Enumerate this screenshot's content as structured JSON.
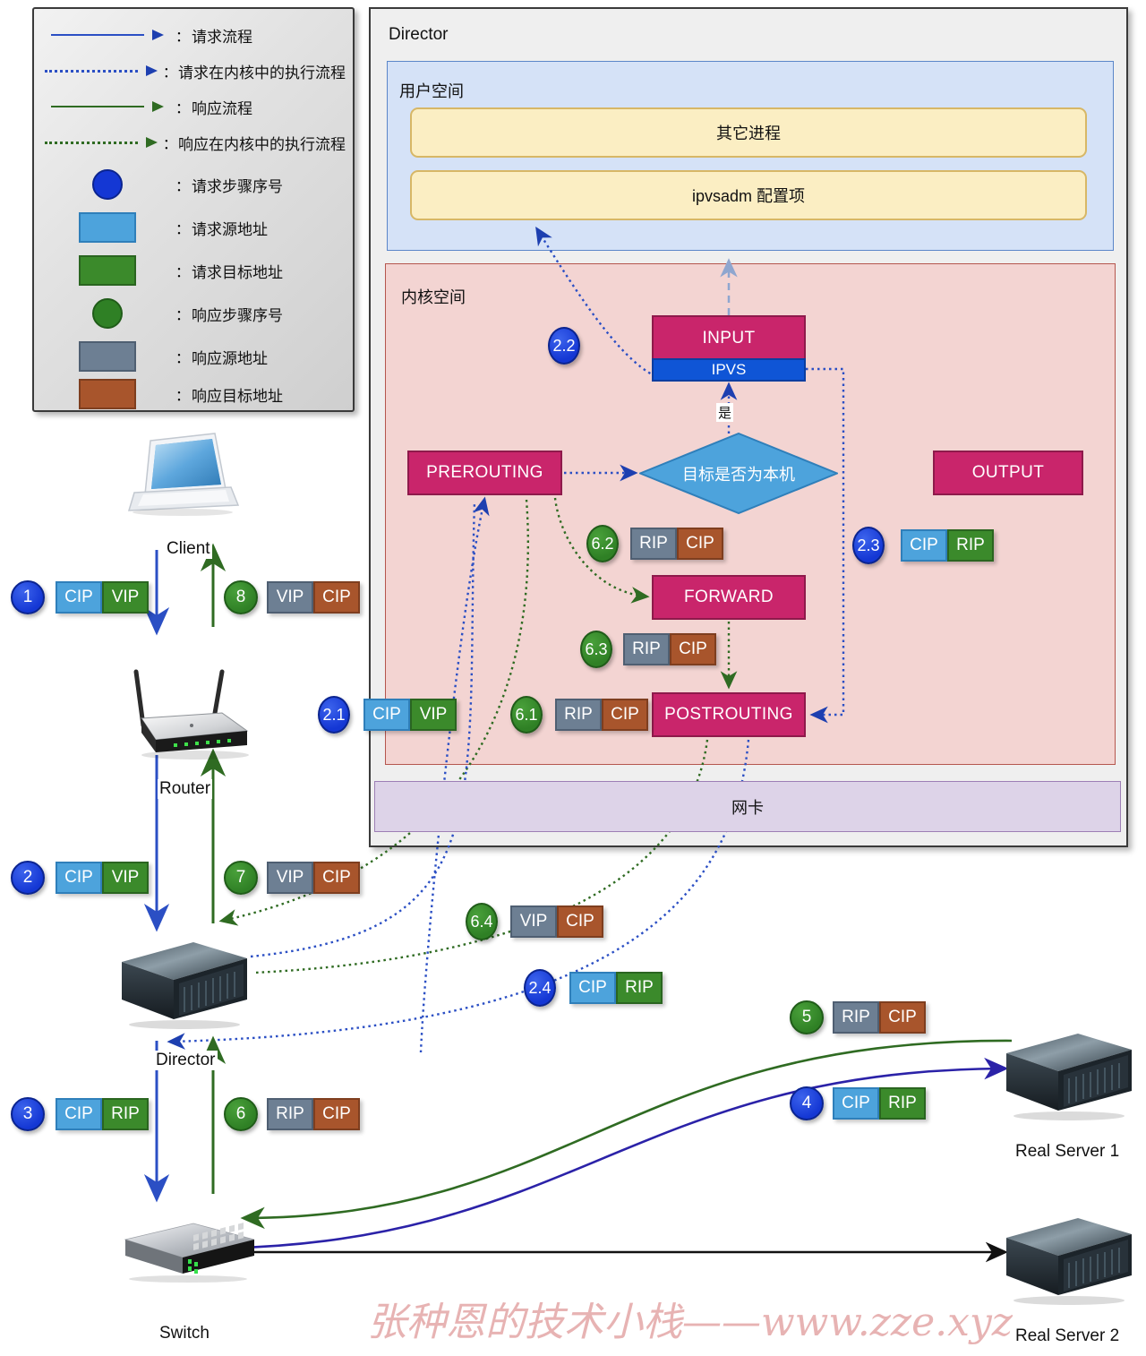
{
  "legend": {
    "items": [
      {
        "sample": "arrow-solid-blue",
        "colon": "：",
        "label": "请求流程"
      },
      {
        "sample": "arrow-dotted-blue",
        "colon": "：",
        "label": "请求在内核中的执行流程"
      },
      {
        "sample": "arrow-solid-green",
        "colon": "：",
        "label": "响应流程"
      },
      {
        "sample": "arrow-dotted-green",
        "colon": "：",
        "label": "响应在内核中的执行流程"
      },
      {
        "sample": "circle-blue",
        "colon": "：",
        "label": "请求步骤序号"
      },
      {
        "sample": "square-lightblue",
        "colon": "：",
        "label": "请求源地址"
      },
      {
        "sample": "square-green",
        "colon": "：",
        "label": "请求目标地址"
      },
      {
        "sample": "circle-green",
        "colon": "：",
        "label": "响应步骤序号"
      },
      {
        "sample": "square-gray",
        "colon": "：",
        "label": "响应源地址"
      },
      {
        "sample": "square-brown",
        "colon": "：",
        "label": "响应目标地址"
      }
    ]
  },
  "director": {
    "title": "Director",
    "userspace": {
      "title": "用户空间",
      "boxes": [
        "其它进程",
        "ipvsadm 配置项"
      ]
    },
    "kernelspace": {
      "title": "内核空间",
      "chains": {
        "input": "INPUT",
        "ipvs": "IPVS",
        "prerouting": "PREROUTING",
        "output": "OUTPUT",
        "forward": "FORWARD",
        "postrouting": "POSTROUTING"
      },
      "decision": "目标是否为本机",
      "decision_yes": "是"
    },
    "nic": "网卡"
  },
  "nodes": {
    "client": "Client",
    "router": "Router",
    "director": "Director",
    "switch": "Switch",
    "real_server_1": "Real Server 1",
    "real_server_2": "Real Server 2"
  },
  "steps": [
    {
      "id": "1",
      "kind": "req",
      "left": "CIP",
      "right": "VIP"
    },
    {
      "id": "2",
      "kind": "req",
      "left": "CIP",
      "right": "VIP"
    },
    {
      "id": "3",
      "kind": "req",
      "left": "CIP",
      "right": "RIP"
    },
    {
      "id": "4",
      "kind": "req",
      "left": "CIP",
      "right": "RIP"
    },
    {
      "id": "5",
      "kind": "resp",
      "left": "RIP",
      "right": "CIP"
    },
    {
      "id": "6",
      "kind": "resp",
      "left": "RIP",
      "right": "CIP"
    },
    {
      "id": "7",
      "kind": "resp",
      "left": "VIP",
      "right": "CIP"
    },
    {
      "id": "8",
      "kind": "resp",
      "left": "VIP",
      "right": "CIP"
    },
    {
      "id": "2.1",
      "kind": "req",
      "left": "CIP",
      "right": "VIP"
    },
    {
      "id": "2.2",
      "kind": "req",
      "left": "",
      "right": ""
    },
    {
      "id": "2.3",
      "kind": "req",
      "left": "CIP",
      "right": "RIP"
    },
    {
      "id": "2.4",
      "kind": "req",
      "left": "CIP",
      "right": "RIP"
    },
    {
      "id": "6.1",
      "kind": "resp",
      "left": "RIP",
      "right": "CIP"
    },
    {
      "id": "6.2",
      "kind": "resp",
      "left": "RIP",
      "right": "CIP"
    },
    {
      "id": "6.3",
      "kind": "resp",
      "left": "RIP",
      "right": "CIP"
    },
    {
      "id": "6.4",
      "kind": "resp",
      "left": "VIP",
      "right": "CIP"
    }
  ],
  "watermark": "张种恩的技术小栈——www.zze.xyz",
  "colors": {
    "request_flow": "#2b4fc4",
    "response_flow": "#2f6b22",
    "chain_box": "#c9256b",
    "ipvs_box": "#0f55d6",
    "decision": "#4da3dc",
    "src_request": "#4da3dc",
    "dst_request": "#3b8a2b",
    "src_response": "#6d7f93",
    "dst_response": "#a8552c",
    "kernel_bg": "#f3d4d2",
    "user_bg": "#d5e2f7",
    "nic_bg": "#ddd3e8"
  }
}
